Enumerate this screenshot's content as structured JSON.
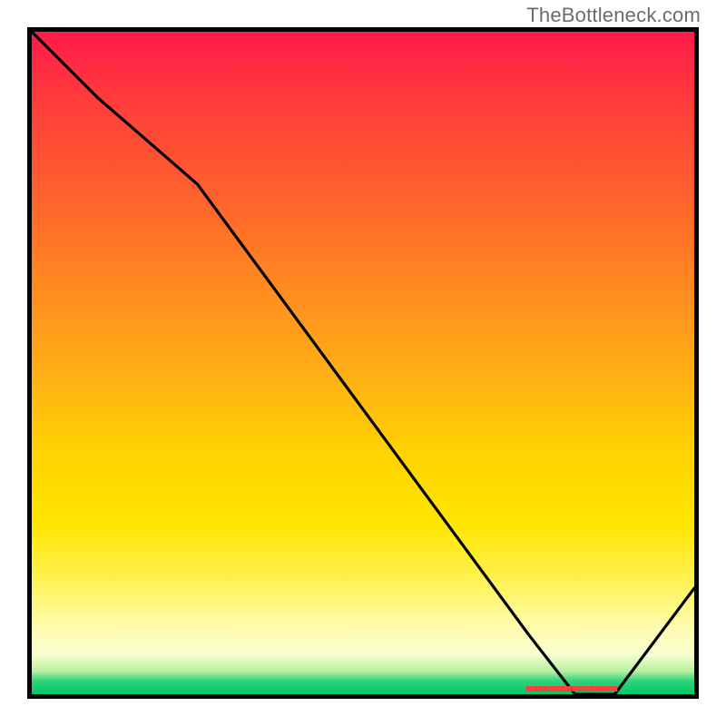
{
  "watermark": "TheBottleneck.com",
  "chart_data": {
    "type": "line",
    "title": "",
    "xlabel": "",
    "ylabel": "",
    "x": [
      0,
      10,
      25,
      50,
      75,
      82,
      88,
      100
    ],
    "values": [
      100,
      90,
      77,
      43,
      9,
      0,
      0,
      16
    ],
    "xlim": [
      0,
      100
    ],
    "ylim": [
      0,
      100
    ],
    "optimal_range_x": [
      75,
      88
    ],
    "gradient_bands": [
      {
        "label": "red",
        "from": 0,
        "to": 0.25,
        "color": "#ff2a45"
      },
      {
        "label": "orange",
        "from": 0.25,
        "to": 0.55,
        "color": "#ff9a1f"
      },
      {
        "label": "yellow",
        "from": 0.55,
        "to": 0.9,
        "color": "#ffe500"
      },
      {
        "label": "pale",
        "from": 0.9,
        "to": 0.97,
        "color": "#fdffc8"
      },
      {
        "label": "green",
        "from": 0.97,
        "to": 1.0,
        "color": "#14cf76"
      }
    ]
  }
}
